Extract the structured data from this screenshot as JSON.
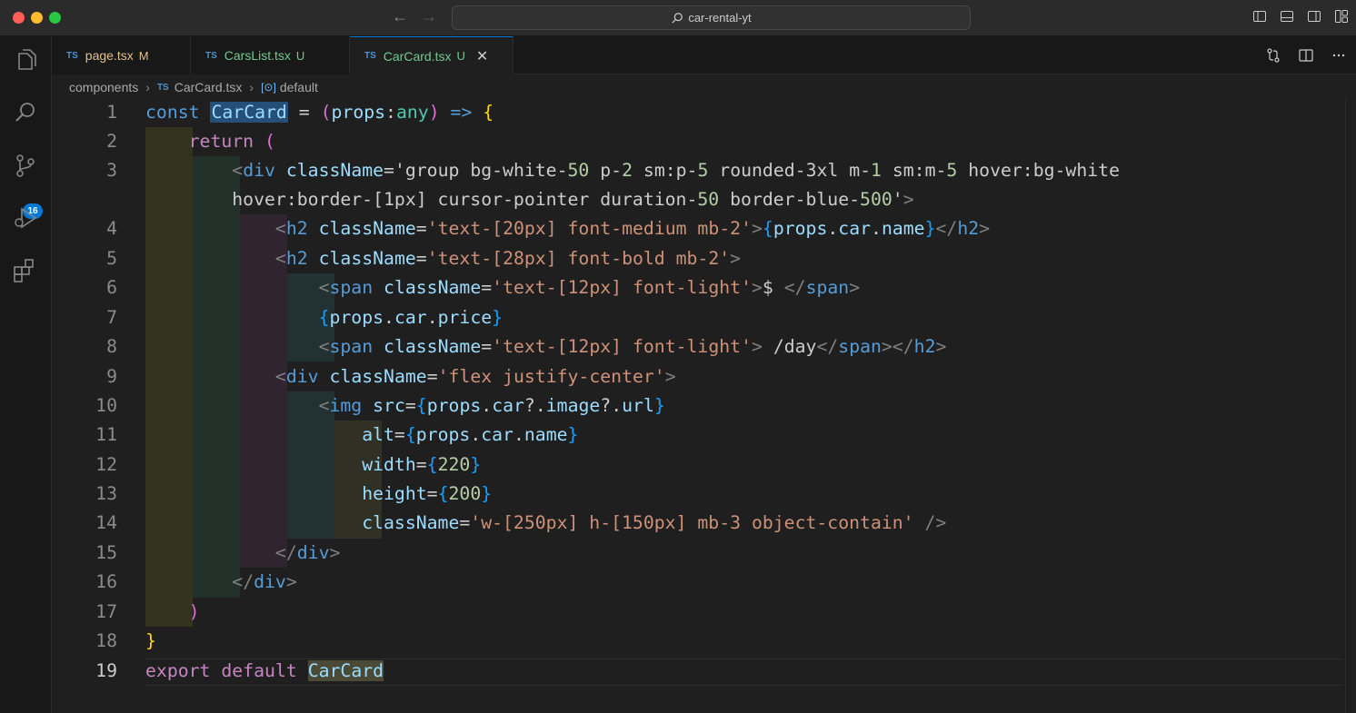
{
  "window": {
    "search_title": "car-rental-yt"
  },
  "activity_bar": {
    "items": [
      "explorer-icon",
      "search-icon",
      "source-control-icon",
      "run-debug-icon",
      "extensions-icon"
    ],
    "source_control_badge": "16"
  },
  "tabs": [
    {
      "lang": "TS",
      "label": "page.tsx",
      "status": "M",
      "color": "#e2c08d"
    },
    {
      "lang": "TS",
      "label": "CarsList.tsx",
      "status": "U",
      "color": "#73c991"
    },
    {
      "lang": "TS",
      "label": "CarCard.tsx",
      "status": "U",
      "color": "#73c991",
      "active": true
    }
  ],
  "breadcrumb": {
    "folder": "components",
    "file_lang": "TS",
    "file": "CarCard.tsx",
    "symbol": "default"
  },
  "editor": {
    "line_numbers": [
      "1",
      "2",
      "3",
      "",
      "4",
      "5",
      "6",
      "7",
      "8",
      "9",
      "10",
      "11",
      "12",
      "13",
      "14",
      "15",
      "16",
      "17",
      "18",
      "19"
    ],
    "lines": [
      "const CarCard = (props:any) => {",
      "    return (",
      "        <div className='group bg-white-50 p-2 sm:p-5 rounded-3xl m-1 sm:m-5 hover:bg-white",
      "        hover:border-[1px] cursor-pointer duration-50 border-blue-500'>",
      "            <h2 className='text-[20px] font-medium mb-2'>{props.car.name}</h2>",
      "            <h2 className='text-[28px] font-bold mb-2'>",
      "                <span className='text-[12px] font-light'>$ </span>",
      "                {props.car.price}",
      "                <span className='text-[12px] font-light'> /day</span></h2>",
      "            <div className='flex justify-center'>",
      "                <img src={props.car?.image?.url}",
      "                    alt={props.car.name}",
      "                    width={220}",
      "                    height={200}",
      "                    className='w-[250px] h-[150px] mb-3 object-contain' />",
      "            </div>",
      "        </div>",
      "    )",
      "}",
      "export default CarCard"
    ]
  }
}
